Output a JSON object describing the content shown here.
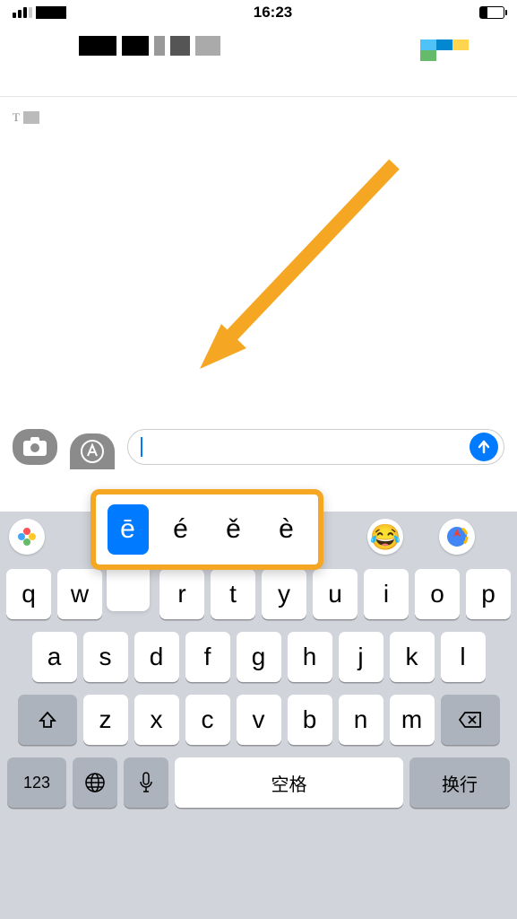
{
  "status": {
    "time": "16:23"
  },
  "conv": {
    "placeholder": "T"
  },
  "accent_popup": {
    "options": [
      "ē",
      "é",
      "ě",
      "è"
    ],
    "selected_index": 0
  },
  "keyboard": {
    "row1": [
      "q",
      "w",
      "",
      "r",
      "t",
      "y",
      "u",
      "i",
      "o",
      "p"
    ],
    "row2": [
      "a",
      "s",
      "d",
      "f",
      "g",
      "h",
      "j",
      "k",
      "l"
    ],
    "row3": [
      "z",
      "x",
      "c",
      "v",
      "b",
      "n",
      "m"
    ],
    "num_key": "123",
    "space_key": "空格",
    "return_key": "换行"
  },
  "colors": {
    "accent": "#007aff",
    "highlight": "#f5a623"
  }
}
